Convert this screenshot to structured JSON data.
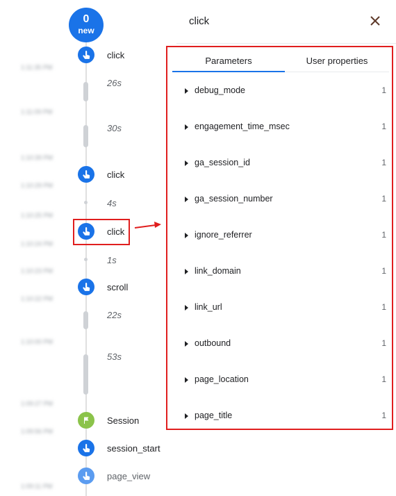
{
  "counter": {
    "value": "0",
    "label": "new"
  },
  "timestamps": [
    "1:11:35 PM",
    "1:11:09 PM",
    "1:10:39 PM",
    "1:10:29 PM",
    "1:10:25 PM",
    "1:10:24 PM",
    "1:10:23 PM",
    "1:10:22 PM",
    "1:10:00 PM",
    "1:09:27 PM",
    "1:09:56 PM",
    "1:09:11 PM"
  ],
  "timeline": {
    "events": [
      {
        "label": "click",
        "icon": "touch-icon"
      },
      {
        "label": "click",
        "icon": "touch-icon"
      },
      {
        "label": "click",
        "icon": "touch-icon"
      },
      {
        "label": "scroll",
        "icon": "touch-icon"
      },
      {
        "label": "Session",
        "icon": "flag-icon"
      },
      {
        "label": "session_start",
        "icon": "touch-icon"
      },
      {
        "label": "page_view",
        "icon": "touch-icon"
      }
    ],
    "gaps": [
      "26s",
      "30s",
      "4s",
      "1s",
      "22s",
      "53s"
    ]
  },
  "panel": {
    "title": "click",
    "tabs": [
      {
        "label": "Parameters",
        "active": true
      },
      {
        "label": "User properties",
        "active": false
      }
    ],
    "parameters": [
      {
        "name": "debug_mode",
        "count": "1"
      },
      {
        "name": "engagement_time_msec",
        "count": "1"
      },
      {
        "name": "ga_session_id",
        "count": "1"
      },
      {
        "name": "ga_session_number",
        "count": "1"
      },
      {
        "name": "ignore_referrer",
        "count": "1"
      },
      {
        "name": "link_domain",
        "count": "1"
      },
      {
        "name": "link_url",
        "count": "1"
      },
      {
        "name": "outbound",
        "count": "1"
      },
      {
        "name": "page_location",
        "count": "1"
      },
      {
        "name": "page_title",
        "count": "1"
      }
    ]
  },
  "colors": {
    "accent": "#1a73e8",
    "annotation": "#e01e1e",
    "session": "#8bc34a"
  }
}
